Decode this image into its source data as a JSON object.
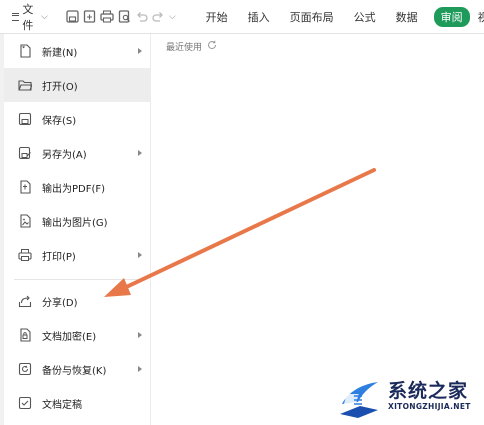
{
  "toolbar": {
    "file_label": "文件",
    "tabs": [
      {
        "label": "开始"
      },
      {
        "label": "插入"
      },
      {
        "label": "页面布局"
      },
      {
        "label": "公式"
      },
      {
        "label": "数据"
      },
      {
        "label": "审阅",
        "active": true
      },
      {
        "label": "视图"
      }
    ],
    "accent_color": "#1e9a5b"
  },
  "menu": {
    "items": [
      {
        "label": "新建(N)",
        "icon": "new-file-icon",
        "submenu": true
      },
      {
        "label": "打开(O)",
        "icon": "open-folder-icon",
        "submenu": false,
        "highlighted": true
      },
      {
        "label": "保存(S)",
        "icon": "save-icon",
        "submenu": false
      },
      {
        "label": "另存为(A)",
        "icon": "save-as-icon",
        "submenu": true
      },
      {
        "label": "输出为PDF(F)",
        "icon": "pdf-icon",
        "submenu": false
      },
      {
        "label": "输出为图片(G)",
        "icon": "image-icon",
        "submenu": false
      },
      {
        "label": "打印(P)",
        "icon": "print-icon",
        "submenu": true
      },
      {
        "label": "分享(D)",
        "icon": "share-icon",
        "submenu": false
      },
      {
        "label": "文档加密(E)",
        "icon": "encrypt-icon",
        "submenu": true
      },
      {
        "label": "备份与恢复(K)",
        "icon": "backup-icon",
        "submenu": true
      },
      {
        "label": "文档定稿",
        "icon": "finalize-icon",
        "submenu": false
      }
    ]
  },
  "content": {
    "recent_label": "最近使用"
  },
  "annotation": {
    "arrow_color": "#e8784a"
  },
  "watermark": {
    "title": "系统之家",
    "url": "XITONGZHIJIA.NET"
  }
}
